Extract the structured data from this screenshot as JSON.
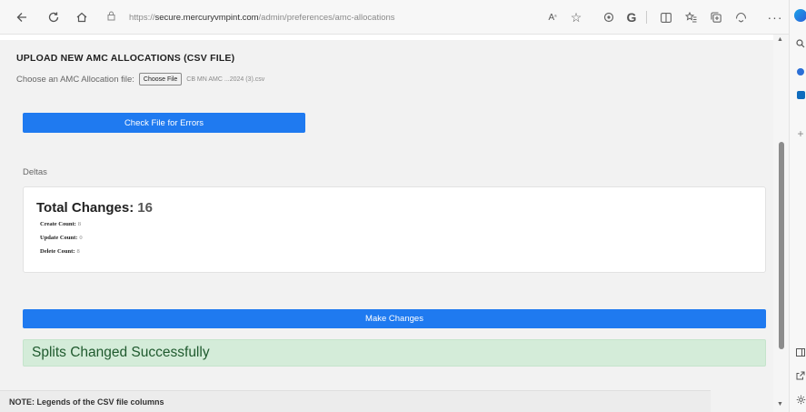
{
  "browser": {
    "url_scheme": "https://",
    "url_host": "secure.mercuryvmpint.com",
    "url_path": "/admin/preferences/amc-allocations",
    "icons": [
      "back-icon",
      "refresh-icon",
      "home-icon",
      "lock-icon",
      "read-aloud-icon",
      "favorite-star-icon",
      "extension-icon",
      "browser-essentials-icon",
      "split-screen-icon",
      "favorites-icon",
      "collections-icon",
      "feedback-icon",
      "more-icon"
    ]
  },
  "upload": {
    "heading": "UPLOAD NEW AMC ALLOCATIONS (CSV FILE)",
    "file_label": "Choose an AMC Allocation file:",
    "choose_button": "Choose File",
    "file_name": "CB MN AMC ...2024 (3).csv"
  },
  "check_button": "Check File for Errors",
  "deltas": {
    "label": "Deltas",
    "total_label": "Total Changes:",
    "total_value": "16",
    "create_label": "Create Count:",
    "create_value": "8",
    "update_label": "Update Count:",
    "update_value": "0",
    "delete_label": "Delete Count:",
    "delete_value": "8"
  },
  "make_changes_button": "Make Changes",
  "success_message": "Splits Changed Successfully",
  "note": "NOTE: Legends of the CSV file columns",
  "colors": {
    "primary_button": "#1f7af0",
    "success_bg": "#d4ecd9",
    "success_text": "#1f5a2e"
  }
}
